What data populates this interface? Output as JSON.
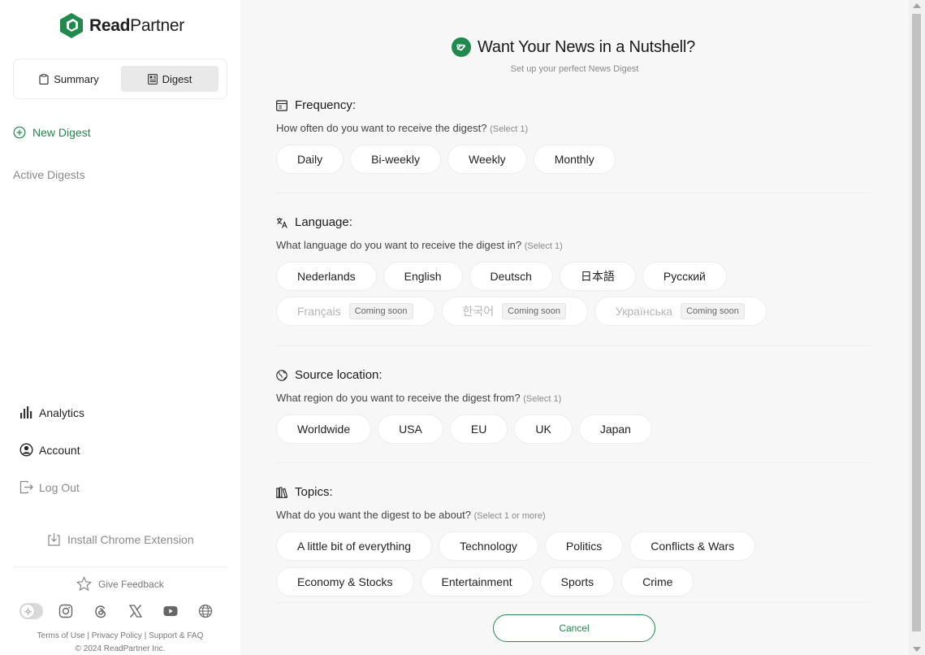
{
  "brand": {
    "name_bold": "Read",
    "name_rest": "Partner",
    "color": "#1f8a4c"
  },
  "mode_switch": {
    "summary": "Summary",
    "digest": "Digest",
    "selected": "Digest"
  },
  "sidebar": {
    "new_digest": "New Digest",
    "active_digests": "Active Digests",
    "nav": [
      {
        "label": "Analytics",
        "icon": "bar-chart-icon"
      },
      {
        "label": "Account",
        "icon": "user-circle-icon"
      },
      {
        "label": "Log Out",
        "icon": "logout-icon"
      }
    ],
    "install": "Install Chrome Extension",
    "feedback": "Give Feedback",
    "socials": [
      "instagram-icon",
      "threads-icon",
      "x-icon",
      "youtube-icon",
      "globe-icon"
    ],
    "legal_links": "Terms of Use | Privacy Policy | Support & FAQ",
    "copyright": "© 2024 ReadPartner Inc."
  },
  "hero": {
    "title": "Want Your News in a Nutshell?",
    "subtitle": "Set up your perfect News Digest"
  },
  "sections": {
    "frequency": {
      "title": "Frequency:",
      "question": "How often do you want to receive the digest?",
      "hint": "(Select 1)",
      "options": [
        "Daily",
        "Bi-weekly",
        "Weekly",
        "Monthly"
      ]
    },
    "language": {
      "title": "Language:",
      "question": "What language do you want to receive the digest in?",
      "hint": "(Select 1)",
      "options": [
        "Nederlands",
        "English",
        "Deutsch",
        "日本語",
        "Русский"
      ],
      "coming": [
        "Français",
        "한국어",
        "Українська"
      ],
      "coming_label": "Coming soon"
    },
    "location": {
      "title": "Source location:",
      "question": "What region do you want to receive the digest from?",
      "hint": "(Select 1)",
      "options": [
        "Worldwide",
        "USA",
        "EU",
        "UK",
        "Japan"
      ]
    },
    "topics": {
      "title": "Topics:",
      "question": "What do you want the digest to be about?",
      "hint": "(Select 1 or more)",
      "options_row1": [
        "A little bit of everything",
        "Technology",
        "Politics",
        "Conflicts & Wars"
      ],
      "options_row2": [
        "Economy & Stocks",
        "Entertainment",
        "Sports",
        "Crime"
      ]
    }
  },
  "cancel": "Cancel"
}
